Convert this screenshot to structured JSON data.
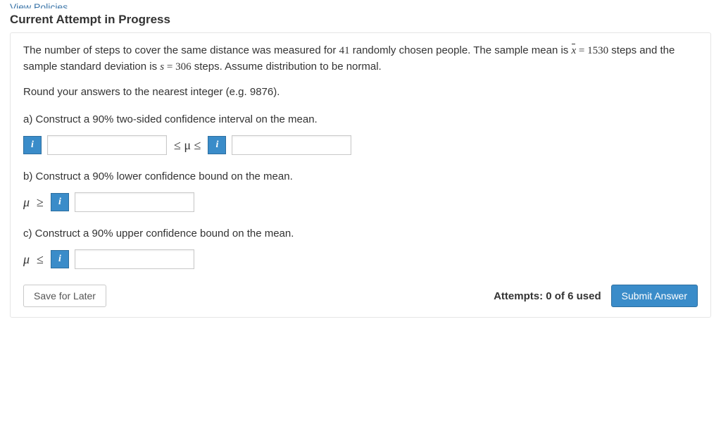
{
  "top_link": "View Policies",
  "section_title": "Current Attempt in Progress",
  "problem": {
    "intro_prefix": "The number of steps to cover the same distance was measured for ",
    "n": "41",
    "intro_mid1": " randomly chosen people. The sample mean is ",
    "xbar_eq": " = ",
    "xbar_val": "1530",
    "intro_mid2": " steps and the sample standard deviation is ",
    "s_eq": " = ",
    "s_val": "306",
    "intro_tail": " steps. Assume distribution to be normal.",
    "hint": "Round your answers to the nearest integer (e.g. 9876)."
  },
  "parts": {
    "a": {
      "label": "a) Construct a 90% two-sided confidence interval on the mean."
    },
    "b": {
      "label": "b) Construct a 90% lower confidence bound on the mean."
    },
    "c": {
      "label": "c) Construct a 90% upper confidence bound on the mean."
    }
  },
  "symbols": {
    "mu": "μ",
    "le": "≤",
    "ge": "≥",
    "le_mu_le": "≤ μ ≤",
    "info": "i",
    "xbar": "x̄",
    "s": "s"
  },
  "inputs": {
    "a_lower": "",
    "a_upper": "",
    "b_bound": "",
    "c_bound": ""
  },
  "buttons": {
    "save": "Save for Later",
    "submit": "Submit Answer"
  },
  "attempts": "Attempts: 0 of 6 used"
}
